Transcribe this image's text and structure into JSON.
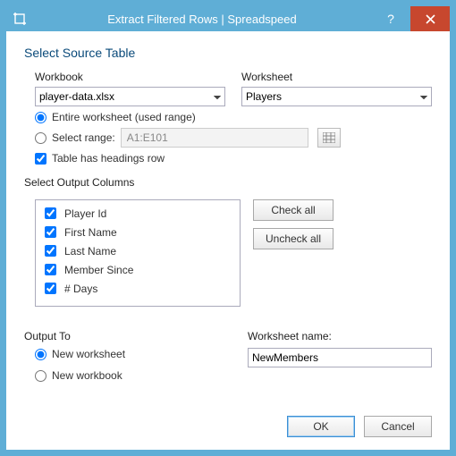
{
  "window": {
    "title": "Extract Filtered Rows  |  Spreadspeed"
  },
  "section_source": {
    "heading": "Select Source Table",
    "workbook_label": "Workbook",
    "workbook_value": "player-data.xlsx",
    "worksheet_label": "Worksheet",
    "worksheet_value": "Players",
    "opt_entire": "Entire worksheet (used range)",
    "opt_range": "Select range:",
    "range_value": "A1:E101",
    "headings_label": "Table has headings row",
    "range_mode": "entire",
    "headings_checked": true
  },
  "section_cols": {
    "heading": "Select Output Columns",
    "items": [
      {
        "label": "Player Id",
        "checked": true
      },
      {
        "label": "First Name",
        "checked": true
      },
      {
        "label": "Last Name",
        "checked": true
      },
      {
        "label": "Member Since",
        "checked": true
      },
      {
        "label": "# Days",
        "checked": true
      }
    ],
    "check_all": "Check all",
    "uncheck_all": "Uncheck all"
  },
  "section_out": {
    "heading": "Output To",
    "opt_new_ws": "New worksheet",
    "opt_new_wb": "New workbook",
    "mode": "new_ws",
    "ws_name_label": "Worksheet name:",
    "ws_name_value": "NewMembers"
  },
  "footer": {
    "ok": "OK",
    "cancel": "Cancel"
  }
}
